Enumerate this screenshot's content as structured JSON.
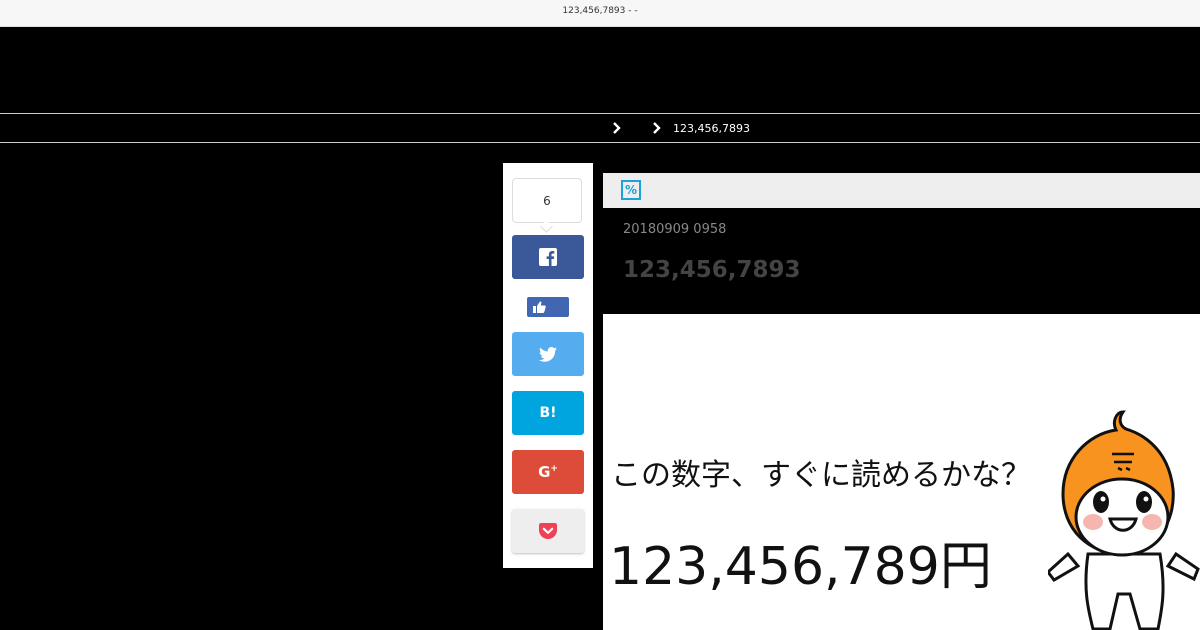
{
  "window": {
    "title": "123,456,7893 -  -"
  },
  "breadcrumb": {
    "current": "123,456,7893"
  },
  "share": {
    "count": "6",
    "facebook_icon": "facebook-icon",
    "like_icon": "thumbs-up-icon",
    "twitter_icon": "twitter-icon",
    "hatena_label": "B!",
    "googleplus_label": "G",
    "googleplus_sup": "+",
    "pocket_icon": "pocket-icon"
  },
  "article": {
    "category_icon": "%",
    "date": "20180909 0958",
    "title": "123,456,7893"
  },
  "eyecatch": {
    "question": "この数字、すぐに読めるかな？",
    "number": "123,456,789円"
  },
  "colors": {
    "facebook": "#3b5998",
    "twitter": "#55acee",
    "hatena": "#00a4de",
    "googleplus": "#dd4b39",
    "pocket": "#ef4056",
    "category": "#1aa3d9"
  }
}
